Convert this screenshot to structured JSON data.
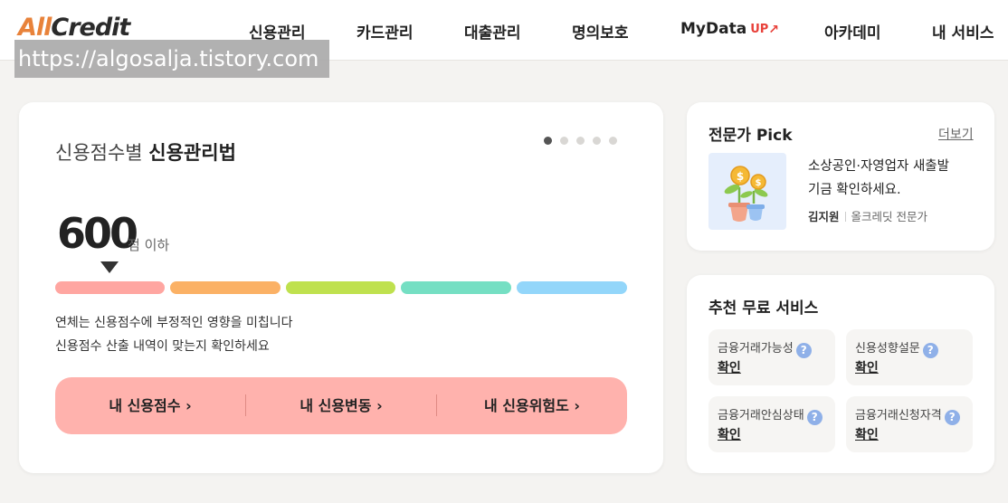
{
  "header": {
    "logo": {
      "part1": "All",
      "part2": "Credit"
    },
    "nav": [
      {
        "label": "신용관리"
      },
      {
        "label": "카드관리"
      },
      {
        "label": "대출관리"
      },
      {
        "label": "명의보호"
      },
      {
        "label": "MyData",
        "badge": "UP"
      },
      {
        "label": "아카데미"
      },
      {
        "label": "내 서비스"
      }
    ],
    "watermark": "https://algosalja.tistory.com"
  },
  "main": {
    "title_prefix": "신용점수별",
    "title_bold": "신용관리법",
    "carousel": {
      "total_slides": 5,
      "active_slide": 1
    },
    "score_value": "600",
    "score_unit": "점 이하",
    "score_bar": {
      "active_segment": 1,
      "colors": [
        "#ffa6a1",
        "#fbb165",
        "#bfe14e",
        "#75dfc3",
        "#93d6fa"
      ]
    },
    "desc_line1": "연체는 신용점수에 부정적인 영향을 미칩니다",
    "desc_line2": "신용점수 산출 내역이 맞는지 확인하세요",
    "buttons": [
      {
        "label": "내 신용점수 ›"
      },
      {
        "label": "내 신용변동 ›"
      },
      {
        "label": "내 신용위험도 ›"
      }
    ]
  },
  "expert": {
    "title": "전문가 Pick",
    "more_label": "더보기",
    "text_line1": "소상공인·자영업자 새출발",
    "text_line2": "기금 확인하세요.",
    "author": "김지원",
    "role": "올크레딧 전문가"
  },
  "services": {
    "title": "추천 무료 서비스",
    "items": [
      {
        "label": "금융거래가능성",
        "action": "확인"
      },
      {
        "label": "신용성향설문",
        "action": "확인"
      },
      {
        "label": "금융거래안심상태",
        "action": "확인"
      },
      {
        "label": "금융거래신청자격",
        "action": "확인"
      }
    ]
  },
  "colors": {
    "accent_orange": "#e8823a",
    "pill_pink": "#ffb2ad",
    "up_red": "#e8413a",
    "help_blue": "#8fb0e8"
  }
}
